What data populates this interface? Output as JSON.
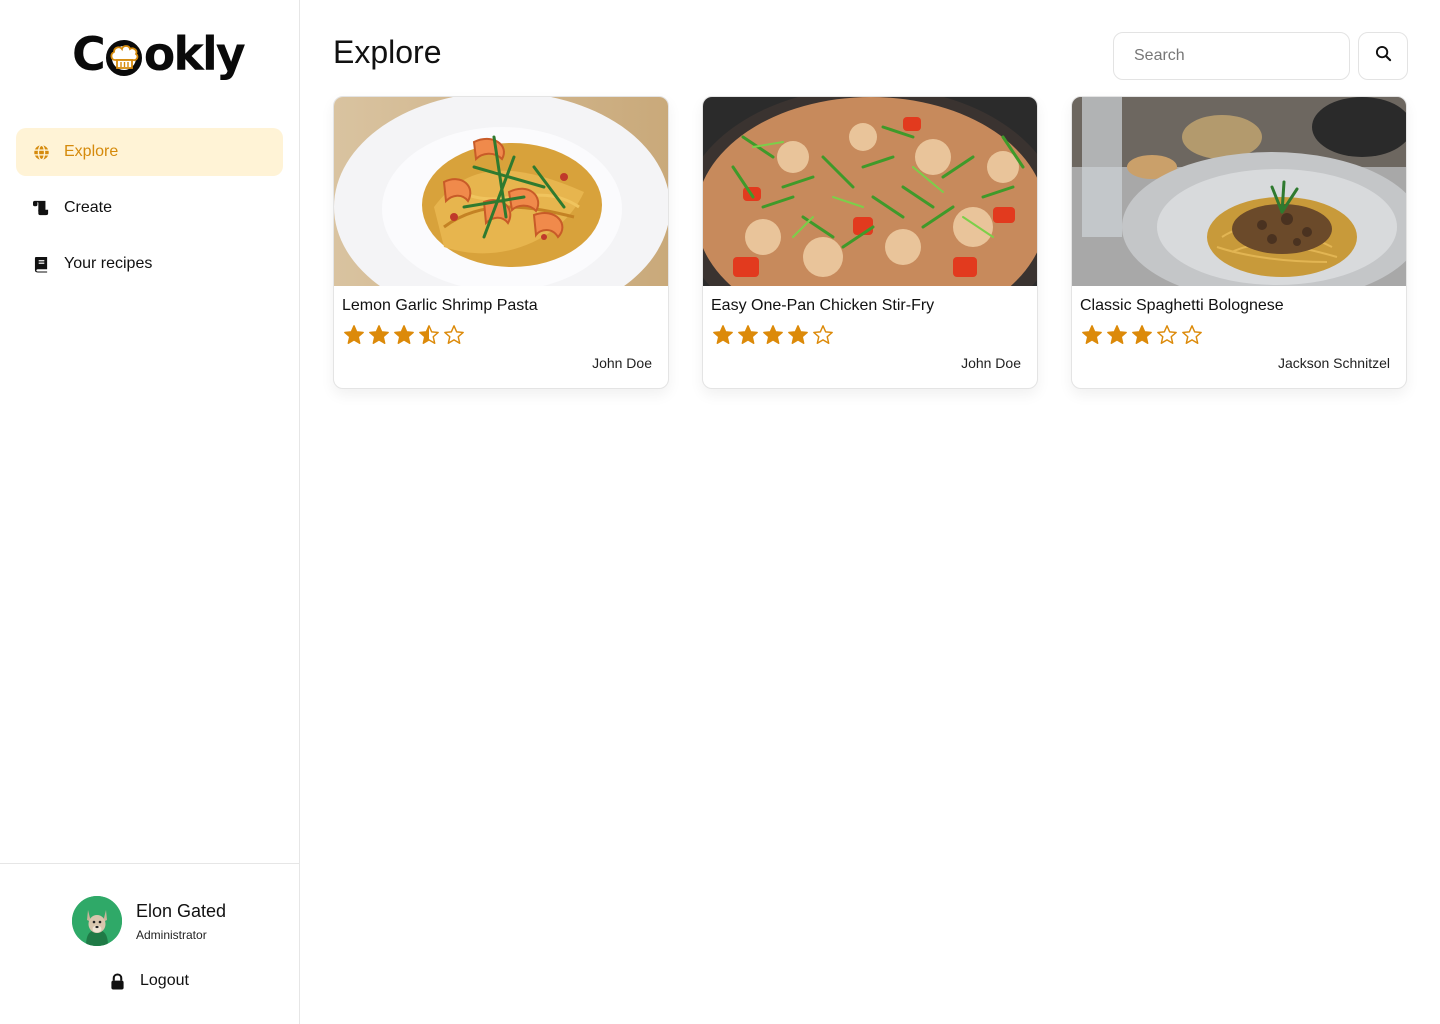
{
  "app": {
    "brand_prefix": "C",
    "brand_suffix": "okly",
    "colors": {
      "accent": "#d58a0c",
      "accent_bg": "#fff3d6",
      "avatar_bg": "#2fa968",
      "star": "#dc8a0a"
    }
  },
  "sidebar": {
    "items": [
      {
        "label": "Explore",
        "icon": "globe-icon",
        "active": true
      },
      {
        "label": "Create",
        "icon": "scroll-icon",
        "active": false
      },
      {
        "label": "Your recipes",
        "icon": "book-icon",
        "active": false
      }
    ],
    "user": {
      "name": "Elon Gated",
      "role": "Administrator",
      "avatar": "dog-avatar"
    },
    "logout_label": "Logout"
  },
  "main": {
    "title": "Explore",
    "search": {
      "placeholder": "Search",
      "button_icon": "search-icon"
    },
    "recipes": [
      {
        "title": "Lemon Garlic Shrimp Pasta",
        "rating": 3.5,
        "max_rating": 5,
        "author": "John Doe",
        "image": "shrimp-pasta-photo"
      },
      {
        "title": "Easy One-Pan Chicken Stir-Fry",
        "rating": 4,
        "max_rating": 5,
        "author": "John Doe",
        "image": "chicken-stir-fry-photo"
      },
      {
        "title": "Classic Spaghetti Bolognese",
        "rating": 3,
        "max_rating": 5,
        "author": "Jackson Schnitzel",
        "image": "spaghetti-bolognese-photo"
      }
    ]
  }
}
